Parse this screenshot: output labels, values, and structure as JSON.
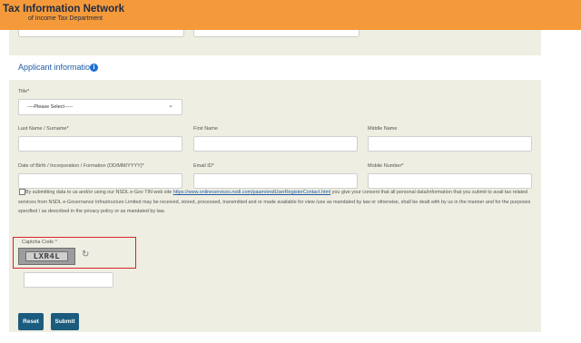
{
  "header": {
    "title": "Tax Information Network",
    "subtitle": "of Income Tax Department"
  },
  "section": {
    "title": "Applicant information",
    "info_icon": "i"
  },
  "form": {
    "title_label": "Title*",
    "title_select_value": "----Please Select-----",
    "last_name_label": "Last Name / Surname*",
    "first_name_label": "First Name",
    "middle_name_label": "Middle Name",
    "dob_label": "Date of Birth / Incorporation / Formation (DD/MM/YYYY)*",
    "email_label": "Email ID*",
    "mobile_label": "Mobile Number*"
  },
  "consent": {
    "text_before": "By submitting data to us and/or using our NSDL e-Gov TIN web site ",
    "link": "https://www.onlineservices.nsdl.com/paam/endUserRegisterContact.html",
    "text_after": " you give your consent that all personal data/information that you submit to avail tax related services from NSDL e-Governance Infrastructure Limited may be received, stored, processed, transmitted and or made available for view /use as mandated by law or otherwise, shall be dealt with by us in the manner and for the purposes specified / as described in the privacy policy or as mandated by law."
  },
  "captcha": {
    "label": "Captcha Code *",
    "code": "LXR4L",
    "refresh_icon": "↻"
  },
  "buttons": {
    "reset": "Reset",
    "submit": "Submit"
  },
  "colors": {
    "header": "#f59a3a",
    "panel": "#eeeee2",
    "button": "#1b5b7e",
    "highlight": "#d9242a"
  }
}
